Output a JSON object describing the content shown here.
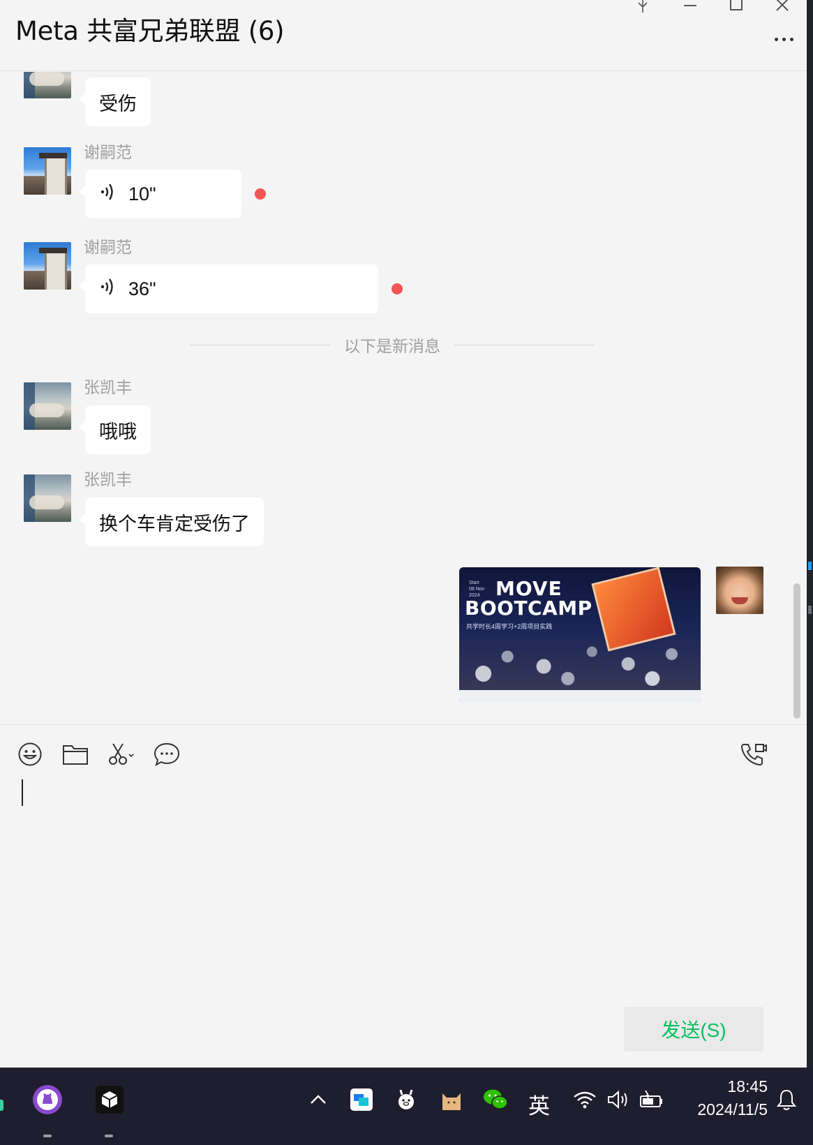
{
  "window": {
    "title": "Meta 共富兄弟联盟 (6)",
    "controls": [
      "pin-icon",
      "minimize-icon",
      "maximize-icon",
      "close-icon"
    ],
    "more_icon": "more-icon"
  },
  "messages": [
    {
      "type": "text",
      "sender": "",
      "avatar": "bed",
      "text": "受伤"
    },
    {
      "type": "voice",
      "sender": "谢嗣范",
      "avatar": "sky",
      "duration": "10\"",
      "unread": true
    },
    {
      "type": "voice",
      "sender": "谢嗣范",
      "avatar": "sky",
      "duration": "36\"",
      "unread": true
    },
    {
      "type": "divider",
      "text": "以下是新消息"
    },
    {
      "type": "text",
      "sender": "张凯丰",
      "avatar": "bed",
      "text": "哦哦"
    },
    {
      "type": "text",
      "sender": "张凯丰",
      "avatar": "bed",
      "text": "换个车肯定受伤了"
    },
    {
      "type": "image",
      "sender": "self",
      "avatar": "baby",
      "image": {
        "line1": "MOVE",
        "line2": "BOOTCAMP",
        "line3": "共学时长4周学习+2周项目实践",
        "date_line1": "Start",
        "date_line2": "08 Nov",
        "date_line3": "2024"
      }
    }
  ],
  "toolbar": {
    "tools": [
      "emoji-icon",
      "folder-icon",
      "scissors-icon",
      "chat-history-icon"
    ],
    "call_icon": "video-call-icon"
  },
  "input": {
    "value": ""
  },
  "send_button": {
    "label": "发送(S)"
  },
  "colors": {
    "send_text": "#07c160",
    "unread_dot": "#f25555",
    "bubble": "#ffffff",
    "window_bg": "#f4f4f4"
  },
  "taskbar": {
    "apps": [
      "github-desktop-icon",
      "cube-app-icon"
    ],
    "tray": [
      "chevron-up-icon",
      "tencent-meeting-icon",
      "ollama-icon",
      "cat-icon",
      "wechat-icon"
    ],
    "ime": "英",
    "status": [
      "wifi-icon",
      "speaker-icon",
      "battery-icon"
    ],
    "time": "18:45",
    "date": "2024/11/5",
    "notification_icon": "bell-icon"
  }
}
